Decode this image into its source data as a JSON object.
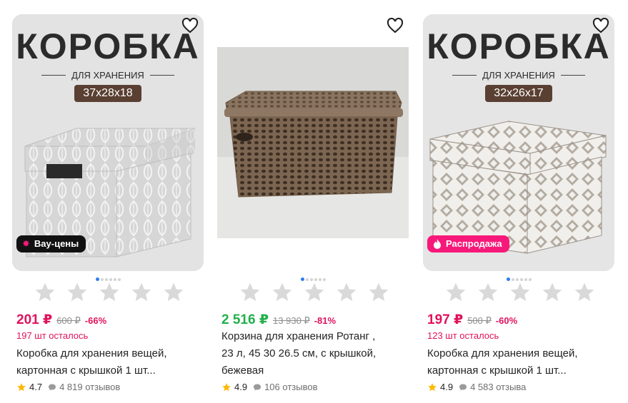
{
  "products": [
    {
      "badge": "Вау-цены",
      "image_heading": "КОРОБКА",
      "image_sub": "ДЛЯ ХРАНЕНИЯ",
      "image_size": "37x28x18",
      "price": "201 ₽",
      "old_price": "600 ₽",
      "discount": "-66%",
      "stock": "197 шт осталось",
      "title_line1": "Коробка для хранения вещей,",
      "title_line2": "картонная с крышкой 1 шт...",
      "rating": "4.7",
      "reviews": "4 819 отзывов"
    },
    {
      "price": "2 516 ₽",
      "old_price": "13 930 ₽",
      "discount": "-81%",
      "title_line1": "Корзина для хранения Ротанг ,",
      "title_line2": "23 л, 45 30 26.5 см, с крышкой,",
      "title_line3": "бежевая",
      "rating": "4.9",
      "reviews": "106 отзывов"
    },
    {
      "badge": "Распродажа",
      "image_heading": "КОРОБКА",
      "image_sub": "ДЛЯ ХРАНЕНИЯ",
      "image_size": "32x26x17",
      "price": "197 ₽",
      "old_price": "500 ₽",
      "discount": "-60%",
      "stock": "123 шт осталось",
      "title_line1": "Коробка для хранения вещей,",
      "title_line2": "картонная с крышкой 1 шт...",
      "rating": "4.9",
      "reviews": "4 583 отзыва"
    }
  ],
  "icons": {
    "favorite": "heart-icon",
    "star": "star-icon",
    "review": "comment-icon",
    "badge1": "sparkle-icon",
    "badge3": "flame-icon"
  },
  "colors": {
    "sale": "#e0135d",
    "green_price": "#20b14a",
    "rating_star": "#ffb800",
    "badge_pink": "#f7197a"
  }
}
